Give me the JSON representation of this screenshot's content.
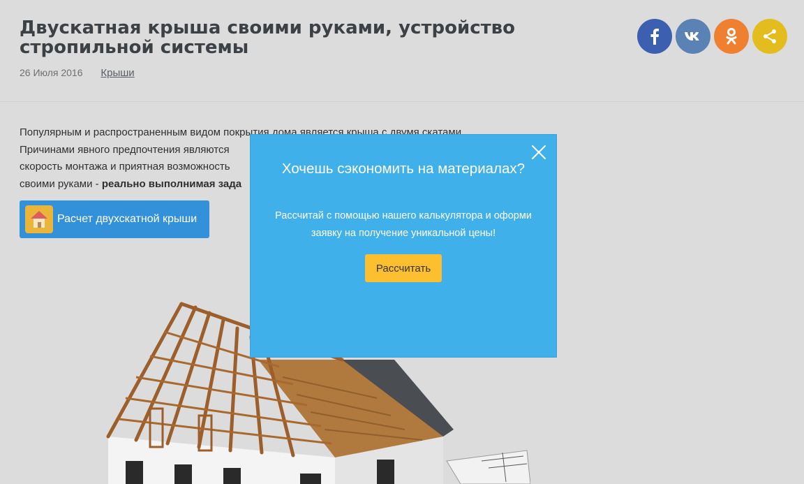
{
  "article": {
    "title": "Двускатная крыша своими руками, устройство стропильной системы",
    "date": "26 Июля 2016",
    "category": "Крыши",
    "para_lines": [
      "Популярным и распространенным видом покрытия дома является крыша с двумя скатами.",
      "Причинами явного предпочтения являются",
      "скорость монтажа и приятная возможность",
      "своими руками - "
    ],
    "para_bold": "реально выполнимая зада",
    "calc_button_label": "Расчет двухскатной крыши"
  },
  "social": [
    {
      "name": "facebook",
      "glyph": "f",
      "color": "#3d5fb0"
    },
    {
      "name": "vk",
      "glyph": "vk",
      "color": "#5b82b4"
    },
    {
      "name": "odnoklassniki",
      "glyph": "ok",
      "color": "#ee8030"
    },
    {
      "name": "share",
      "glyph": "share",
      "color": "#e3bd1e"
    }
  ],
  "popup": {
    "title": "Хочешь сэкономить на материалах?",
    "text": "Рассчитай с помощью нашего калькулятора и оформи заявку на получение уникальной цены!",
    "cta_label": "Рассчитать",
    "bg_color": "#40b0ea",
    "cta_color": "#fbbf2f"
  }
}
